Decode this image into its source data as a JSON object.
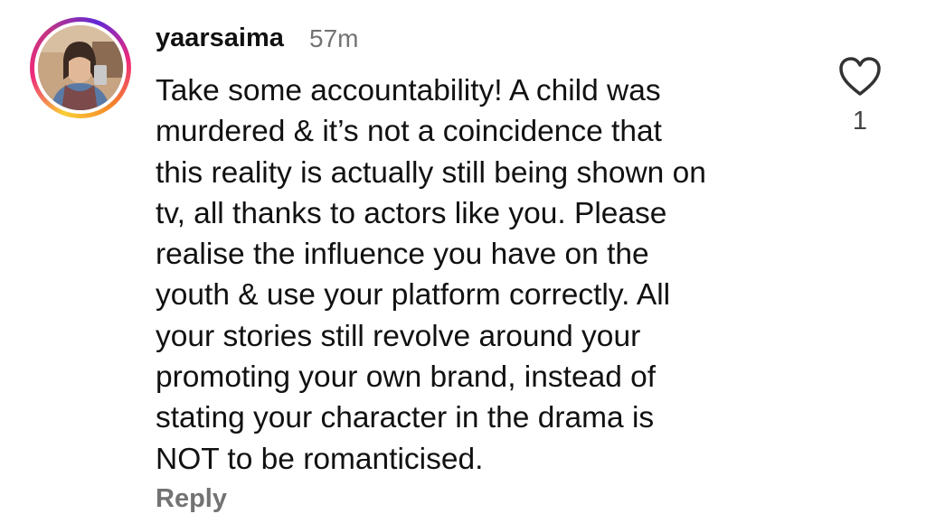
{
  "comment": {
    "username": "yaarsaima",
    "time": "57m",
    "lines": [
      "Take some accountability! A child was",
      "murdered & it’s not a coincidence that",
      "this reality is actually still being shown on",
      "tv, all thanks to actors like you. Please",
      "realise the influence you have on the",
      "youth & use your platform correctly. All",
      "your stories still revolve around your",
      "promoting your own brand, instead of",
      "stating your character in the drama is",
      "NOT to be romanticised."
    ],
    "like_icon": "heart-outline-icon",
    "like_count": "1",
    "reply_label": "Reply"
  },
  "colors": {
    "text": "#111111",
    "secondary_text": "#737373",
    "story_ring": [
      "#f9ce34",
      "#ee2a7b",
      "#6228d7"
    ]
  }
}
